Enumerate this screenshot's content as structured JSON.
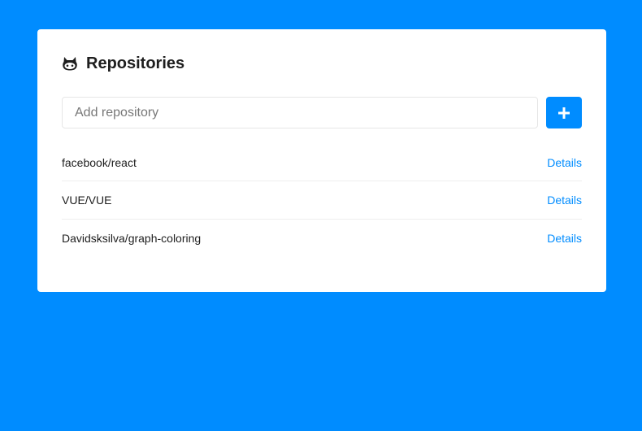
{
  "header": {
    "title": "Repositories",
    "icon": "github-icon"
  },
  "form": {
    "placeholder": "Add repository",
    "value": "",
    "add_label": "+"
  },
  "repositories": [
    {
      "name": "facebook/react",
      "action": "Details"
    },
    {
      "name": "VUE/VUE",
      "action": "Details"
    },
    {
      "name": "Davidsksilva/graph-coloring",
      "action": "Details"
    }
  ],
  "colors": {
    "background": "#008cff",
    "accent": "#008cff",
    "card": "#ffffff"
  }
}
